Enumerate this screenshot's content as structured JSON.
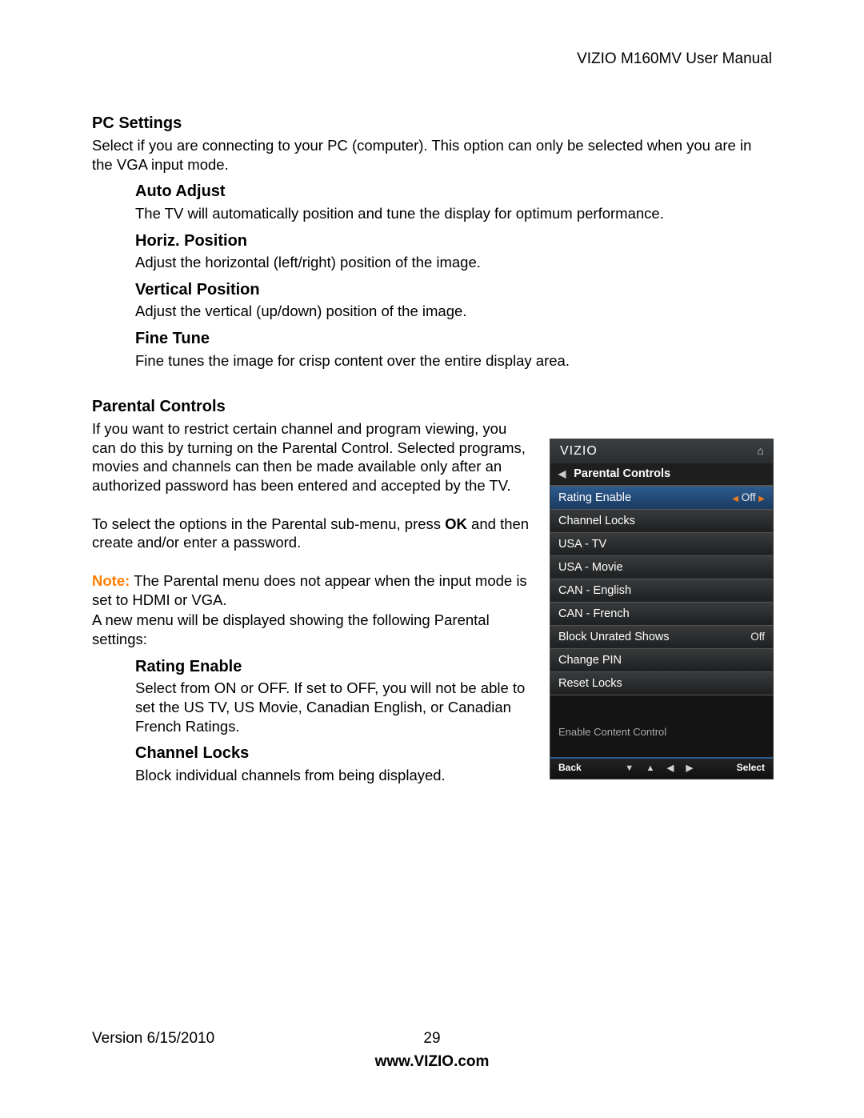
{
  "header": {
    "doc_title": "VIZIO M160MV User Manual"
  },
  "sections": {
    "pc_settings": {
      "title": "PC Settings",
      "intro": "Select if you are connecting to your PC (computer). This option can only be selected when you are in the VGA input mode.",
      "items": {
        "auto_adjust": {
          "title": "Auto Adjust",
          "body": "The TV will automatically position and tune the display for optimum performance."
        },
        "horiz_position": {
          "title": "Horiz. Position",
          "body": "Adjust the horizontal (left/right) position of the image."
        },
        "vertical_position": {
          "title": "Vertical Position",
          "body": "Adjust the vertical (up/down) position of the image."
        },
        "fine_tune": {
          "title": "Fine Tune",
          "body": "Fine tunes the image for crisp content over the entire display area."
        }
      }
    },
    "parental_controls": {
      "title": "Parental Controls",
      "p1": "If you want to restrict certain channel and program viewing, you can do this by turning on the Parental Control. Selected programs, movies and channels can then be made available only after an authorized password has been entered and accepted by the TV.",
      "p2a": "To select the options in the Parental sub-menu, press ",
      "p2b_bold": "OK",
      "p2c": " and then create and/or enter a password.",
      "note_label": "Note:",
      "note_body": " The Parental menu does not appear when the input mode is set to HDMI or VGA.",
      "p3": "A new menu will be displayed showing the following Parental settings:",
      "items": {
        "rating_enable": {
          "title": "Rating Enable",
          "body": "Select from ON or OFF. If set to OFF, you will not be able to set the US TV, US Movie, Canadian English, or Canadian French Ratings."
        },
        "channel_locks": {
          "title": "Channel Locks",
          "body": "Block individual channels from being displayed."
        }
      }
    }
  },
  "osd": {
    "brand": "VIZIO",
    "breadcrumb": "Parental Controls",
    "helper": "Enable Content Control",
    "back_label": "Back",
    "select_label": "Select",
    "rows": {
      "rating_enable": {
        "label": "Rating Enable",
        "value": "Off"
      },
      "channel_locks": {
        "label": "Channel Locks"
      },
      "usa_tv": {
        "label": "USA - TV"
      },
      "usa_movie": {
        "label": "USA - Movie"
      },
      "can_english": {
        "label": "CAN - English"
      },
      "can_french": {
        "label": "CAN - French"
      },
      "block_unrated": {
        "label": "Block Unrated Shows",
        "value": "Off"
      },
      "change_pin": {
        "label": "Change PIN"
      },
      "reset_locks": {
        "label": "Reset Locks"
      }
    }
  },
  "footer": {
    "version": "Version 6/15/2010",
    "page": "29",
    "site": "www.VIZIO.com"
  }
}
